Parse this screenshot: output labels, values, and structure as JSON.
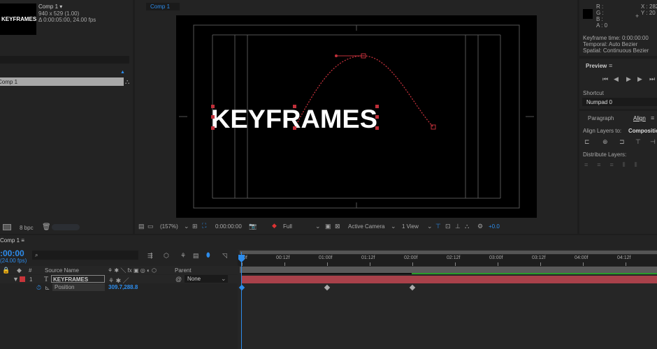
{
  "project": {
    "comp_name": "Comp 1 ▾",
    "dimensions": "940 x 529 (1.00)",
    "duration": "Δ 0:00:05:00, 24.00 fps",
    "thumbnail_text": "KEYFRAMES",
    "list_item": "Comp 1",
    "bpc": "8 bpc"
  },
  "viewer": {
    "tab": "Comp 1",
    "canvas_text": "KEYFRAMES",
    "toolbar": {
      "zoom": "(157%)",
      "timecode": "0:00:00:00",
      "resolution": "Full",
      "camera": "Active Camera",
      "views": "1 View",
      "exposure": "+0.0"
    }
  },
  "info": {
    "r": "R :",
    "g": "G :",
    "b": "B :",
    "a": "A : 0",
    "x": "X : 282",
    "y": "Y : 20",
    "keyframe_time": "Keyframe time: 0:00:00:00",
    "temporal": "Temporal: Auto Bezier",
    "spatial": "Spatial: Continuous Bezier"
  },
  "preview": {
    "title": "Preview",
    "shortcut_label": "Shortcut",
    "shortcut_value": "Numpad 0"
  },
  "align": {
    "tab_paragraph": "Paragraph",
    "tab_align": "Align",
    "align_to_label": "Align Layers to:",
    "align_to_value": "Composition",
    "distribute_label": "Distribute Layers:"
  },
  "timeline": {
    "tab": "Comp 1",
    "timecode": ":00:00",
    "fps": "(24.00 fps)",
    "columns": {
      "num": "#",
      "source": "Source Name",
      "switches": "⚘ ✱ ＼ fx ▣ ◎ ◐ ⬡",
      "parent": "Parent"
    },
    "layer": {
      "index": "1",
      "type": "T",
      "name": "KEYFRAMES",
      "parent": "None",
      "color": "#c8353a"
    },
    "property": {
      "name": "Position",
      "value": "309.7,288.8"
    },
    "ruler": [
      "0f",
      "00:12f",
      "01:00f",
      "01:12f",
      "02:00f",
      "02:12f",
      "03:00f",
      "03:12f",
      "04:00f",
      "04:12f"
    ],
    "keyframes_seconds": [
      0,
      1,
      2
    ]
  }
}
